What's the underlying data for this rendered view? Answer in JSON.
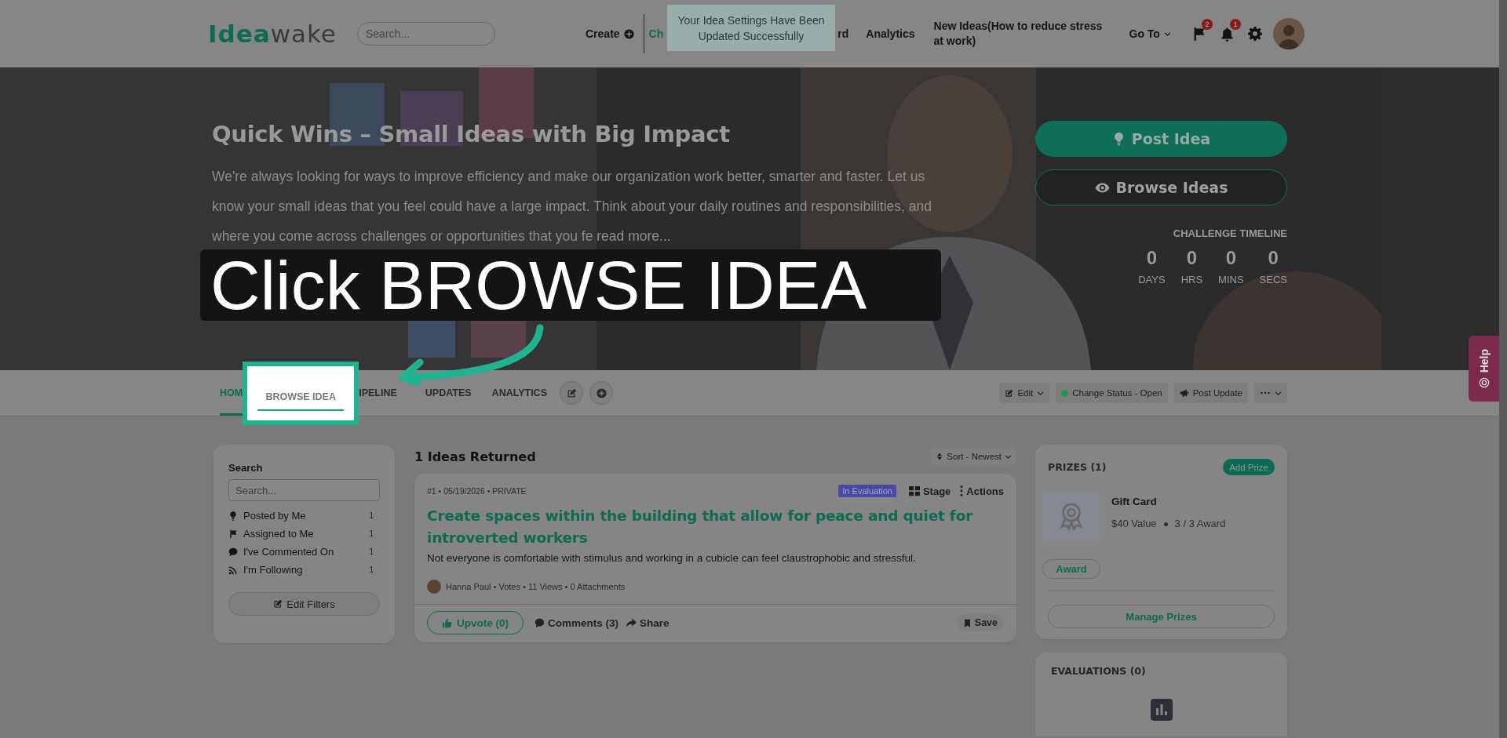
{
  "header": {
    "logo": [
      "Idea",
      "wake"
    ],
    "search_placeholder": "Search...",
    "nav": [
      {
        "label": "Create",
        "kind": "create",
        "selected": false
      },
      {
        "label": "Ch",
        "kind": "link",
        "selected": true
      },
      {
        "label": "rd",
        "kind": "link",
        "selected": false
      },
      {
        "label": "Analytics",
        "kind": "link",
        "selected": false
      },
      {
        "label": "New Ideas(How to reduce stress at work)",
        "kind": "link",
        "selected": false
      },
      {
        "label": "Go To",
        "kind": "menu",
        "selected": false
      }
    ],
    "notifications": [
      {
        "kind": "flag",
        "count": "2"
      },
      {
        "kind": "bell",
        "count": "1"
      }
    ]
  },
  "toast": "Your Idea Settings Have Been Updated Successfully",
  "hero": {
    "title": "Quick Wins – Small Ideas with Big Impact",
    "description": "We're always looking for ways to improve efficiency and make our organization work better, smarter and faster. Let us know your small ideas that you feel could have a large impact. Think about your daily routines and responsibilities, and where you come across challenges or opportunities that you fe read more...",
    "buttons": [
      {
        "label": "Post Idea",
        "kind": "primary"
      },
      {
        "label": "Browse Ideas",
        "kind": "outline"
      }
    ],
    "timeline": {
      "title": "CHALLENGE TIMELINE",
      "units": [
        {
          "value": "0",
          "label": "DAYS"
        },
        {
          "value": "0",
          "label": "HRS"
        },
        {
          "value": "0",
          "label": "MINS"
        },
        {
          "value": "0",
          "label": "SECS"
        }
      ]
    }
  },
  "tabs": [
    {
      "label": "HOM",
      "selected": true,
      "highlighted": false
    },
    {
      "label": "BROWSE IDEA",
      "selected": false,
      "highlighted": true
    },
    {
      "label": "IPELINE",
      "selected": false,
      "highlighted": false
    },
    {
      "label": "UPDATES",
      "selected": false,
      "highlighted": false
    },
    {
      "label": "ANALYTICS",
      "selected": false,
      "highlighted": false
    }
  ],
  "tab_actions": [
    {
      "kind": "edit",
      "label": "Edit"
    },
    {
      "kind": "status",
      "label": "Change Status - Open",
      "color": "#1d9a52"
    },
    {
      "kind": "update",
      "label": "Post Update"
    },
    {
      "kind": "more"
    }
  ],
  "sidebar": {
    "title": "Search",
    "placeholder": "Search...",
    "filters": [
      {
        "kind": "bulb",
        "label": "Posted by Me",
        "count": "1"
      },
      {
        "kind": "flag",
        "label": "Assigned to Me",
        "count": "1"
      },
      {
        "kind": "comment",
        "label": "I've Commented On",
        "count": "1"
      },
      {
        "kind": "rss",
        "label": "I'm Following",
        "count": "1"
      }
    ],
    "button": "Edit Filters"
  },
  "ideas": {
    "count_label": "1 Ideas Returned",
    "sort": "Sort - Newest",
    "items": [
      {
        "meta": "#1 • 05/19/2026 • PRIVATE",
        "status": "In Evaluation",
        "stage": "Stage",
        "actions": "Actions",
        "title": "Create spaces within the building that allow for peace and quiet for introverted workers",
        "description": "Not everyone is comfortable with stimulus and working in a cubicle can feel claustrophobic and stressful.",
        "byline": "Hanna Paul • Votes • 11 Views • 0 Attachments",
        "upvote": "Upvote (0)",
        "comments": "Comments (3)",
        "share": "Share",
        "save": "Save"
      }
    ]
  },
  "prizes": {
    "title": "PRIZES (1)",
    "add": "Add Prize",
    "items": [
      {
        "name": "Gift Card",
        "value": "$40 Value",
        "awards": "3 / 3 Award",
        "button": "Award"
      }
    ],
    "manage": "Manage Prizes"
  },
  "evaluations": {
    "title": "EVALUATIONS (0)"
  },
  "help": "Help",
  "tutorial": {
    "caption": "Click BROWSE IDEA"
  }
}
